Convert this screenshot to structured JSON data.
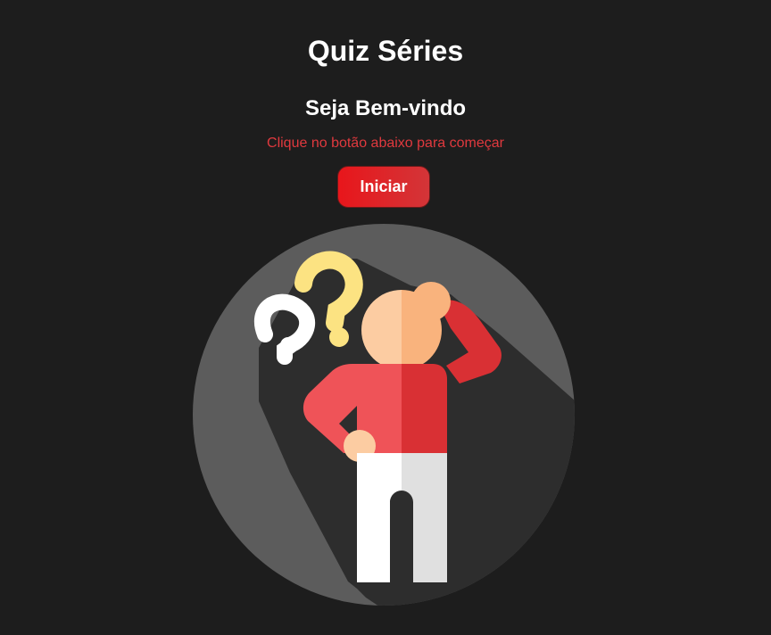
{
  "header": {
    "title": "Quiz Séries",
    "welcome": "Seja Bem-vindo",
    "instruction": "Clique no botão abaixo para começar"
  },
  "actions": {
    "start_label": "Iniciar"
  },
  "illustration": {
    "icon": "confused-person-icon",
    "colors": {
      "circle": "#5c5c5c",
      "shadow": "#2d2d2d",
      "shirt": "#ef5358",
      "shirt_dark": "#d93034",
      "skin": "#fccca2",
      "skin_dark": "#f9b37d",
      "pants": "#ffffff",
      "pants_dark": "#e0e0e0",
      "question_yellow": "#fce382",
      "question_white": "#ffffff"
    }
  },
  "theme": {
    "background": "#1d1d1d",
    "accent": "#e8161b",
    "instruction_color": "#e0393e"
  }
}
